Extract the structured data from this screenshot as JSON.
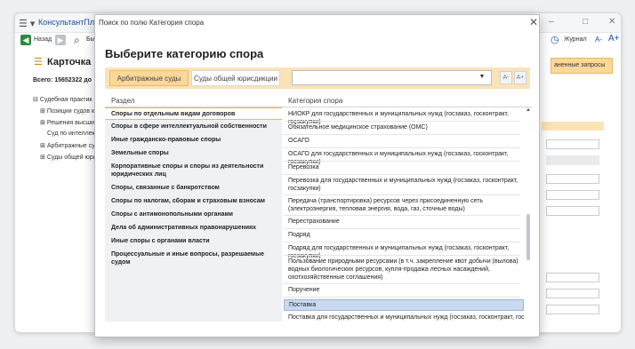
{
  "app": {
    "title": "КонсультантПлюс",
    "menu_icon": "hamburger-icon",
    "window_controls": [
      "–",
      "□",
      "✕"
    ]
  },
  "toolbar": {
    "back_label": "Назад",
    "search_partial": "Бы",
    "journal_label": "Журнал",
    "font_smaller": "A-",
    "font_larger": "A+"
  },
  "background": {
    "card_title": "Карточка по",
    "total": "Всего: 15652322 до",
    "saved_queries_label": "аненные запросы",
    "tree": [
      {
        "label": "Судебная практик",
        "level": 0,
        "expander": "⊟"
      },
      {
        "label": "Позиции судов к",
        "level": 1,
        "expander": "⊞"
      },
      {
        "label": "Решения высши",
        "level": 1,
        "expander": "⊞"
      },
      {
        "label": "Суд по интеллек",
        "level": 1,
        "expander": ""
      },
      {
        "label": "Арбитражные су",
        "level": 1,
        "expander": "⊞"
      },
      {
        "label": "Суды общей юри",
        "level": 1,
        "expander": "⊞"
      }
    ]
  },
  "dialog": {
    "title": "Поиск по полю Категория спора",
    "heading": "Выберите категорию спора",
    "close_icon": "close-icon",
    "tabs": [
      {
        "label": "Арбитражные суды",
        "active": true
      },
      {
        "label": "Суды общей юрисдикции",
        "active": false
      }
    ],
    "search_value": "",
    "font_smaller": "A-",
    "font_larger": "A+",
    "left_header": "Раздел",
    "right_header": "Категория спора",
    "sections": [
      "Споры по отдельным видам договоров",
      "Споры в сфере интеллектуальной собственности",
      "Иные гражданско-правовые споры",
      "Земельные споры",
      "Корпоративные споры и споры из деятельности юридических лиц",
      "Споры, связанные с банкротством",
      "Споры по налогам, сборам и страховым взносам",
      "Споры с антимонопольными органами",
      "Дела об административных правонарушениях",
      "Иные споры с органами власти",
      "Процессуальные и иные вопросы, разрешаемые судом"
    ],
    "selected_section": 0,
    "categories": [
      "НИОКР для государственных и муниципальных нужд (госзаказ, госконтракт, госзакупки)",
      "Обязательное медицинское страхование (ОМС)",
      "ОСАГО",
      "ОСАГО для государственных и муниципальных нужд (госзаказ, госконтракт, госзакупки)",
      "Перевозка",
      "Перевозка для государственных и муниципальных нужд (госзаказ, госконтракт, госзакупки)",
      "Передача (транспортировка) ресурсов через присоединенную сеть (электроэнергия, тепловая энергия, вода, газ, сточные воды)",
      "Перестрахование",
      "Подряд",
      "Подряд для государственных и муниципальных нужд (госзаказ, госконтракт, госзакупки)",
      "Пользование природными ресурсами (в т.ч. закрепление квот добычи (вылова) водных биологических ресурсов, купля-продажа лесных насаждений, охотхозяйственные соглашения)",
      "Поручение",
      "Поставка",
      "Поставка для государственных и муниципальных нужд (госзаказ, госконтракт, госзакупки)"
    ],
    "selected_category": 12
  },
  "colors": {
    "accent_orange": "#fbd79a",
    "tab_bar": "#fbe3b8",
    "selection_blue": "#c9d9ef",
    "brand_blue": "#1a4fa0"
  }
}
